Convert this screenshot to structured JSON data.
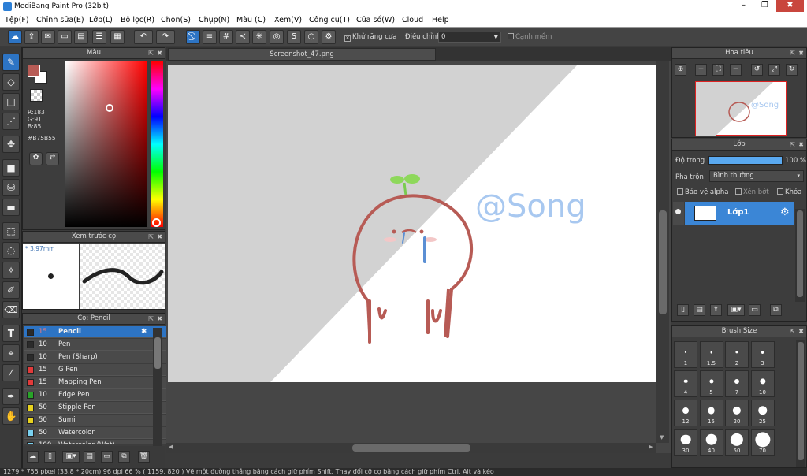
{
  "window": {
    "title": "MediBang Paint Pro (32bit)",
    "min": "–",
    "max": "❐",
    "close": "✖"
  },
  "menu": [
    "Tệp(F)",
    "Chỉnh sửa(E)",
    "Lớp(L)",
    "Bộ lọc(R)",
    "Chọn(S)",
    "Chụp(N)",
    "Màu (C)",
    "Xem(V)",
    "Công cụ(T)",
    "Cửa sổ(W)",
    "Cloud",
    "Help"
  ],
  "toolbar": {
    "antialias_label": "Khử răng cưa",
    "adjust_label": "Điều chỉnh",
    "adjust_value": "0",
    "smooth_label": "Cạnh mềm"
  },
  "color_panel": {
    "title": "Màu",
    "r": "R:183",
    "g": "G:91",
    "b": "B:85",
    "hex": "#B75B55",
    "fg": "#B75B55",
    "bg": "#FFFFFF"
  },
  "brush_preview": {
    "title": "Xem trước cọ",
    "size": "* 3.97mm"
  },
  "brush_list": {
    "title": "Cọ: Pencil",
    "items": [
      {
        "size": "15",
        "name": "Pencil",
        "color": "#2b2b2b",
        "selected": true
      },
      {
        "size": "10",
        "name": "Pen",
        "color": "#2b2b2b"
      },
      {
        "size": "10",
        "name": "Pen (Sharp)",
        "color": "#2b2b2b"
      },
      {
        "size": "15",
        "name": "G Pen",
        "color": "#e23a3a"
      },
      {
        "size": "15",
        "name": "Mapping Pen",
        "color": "#e23a3a"
      },
      {
        "size": "10",
        "name": "Edge Pen",
        "color": "#28a428"
      },
      {
        "size": "50",
        "name": "Stipple Pen",
        "color": "#e8d21e"
      },
      {
        "size": "50",
        "name": "Sumi",
        "color": "#e8d21e"
      },
      {
        "size": "50",
        "name": "Watercolor",
        "color": "#79d1f0"
      },
      {
        "size": "100",
        "name": "Watercolor (Wet)",
        "color": "#79d1f0"
      }
    ]
  },
  "canvas": {
    "tab": "Screenshot_47.png",
    "signature": "@Song"
  },
  "navigator": {
    "title": "Hoa tiêu"
  },
  "layers": {
    "title": "Lớp",
    "opacity_label": "Độ trong",
    "opacity_value": "100 %",
    "opacity_fraction": 1.0,
    "blend_label": "Pha trộn",
    "blend_value": "Bình thường",
    "protect_alpha": "Bảo vệ alpha",
    "clip": "Xén bớt",
    "lock": "Khóa",
    "layer_name": "Lớp1"
  },
  "brush_size": {
    "title": "Brush Size",
    "sizes": [
      "1",
      "1.5",
      "2",
      "3",
      "4",
      "5",
      "7",
      "10",
      "12",
      "15",
      "20",
      "25",
      "30",
      "40",
      "50",
      "70"
    ]
  },
  "status": "1279 * 755 pixel   (33.8 * 20cm)   96 dpi   66 %   ( 1159, 820 )   Vẽ một đường thẳng bằng cách giữ phím Shift. Thay đổi cỡ cọ bằng cách giữ phím Ctrl, Alt và kéo"
}
